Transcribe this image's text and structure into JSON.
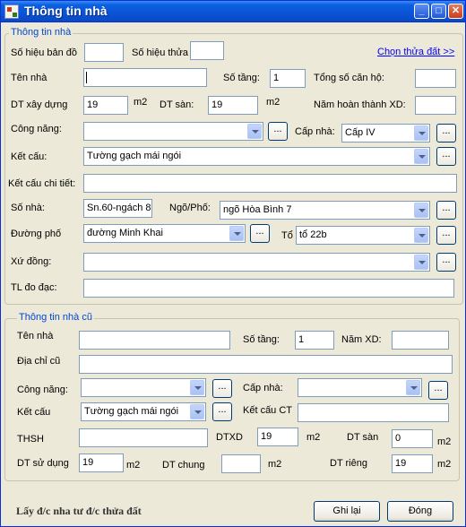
{
  "window": {
    "title": "Thông tin nhà",
    "minimize": "_",
    "maximize": "□",
    "close": "✕"
  },
  "current": {
    "group_title": "Thông tin nhà",
    "so_hieu_ban_do_label": "Số hiệu bản đồ",
    "so_hieu_ban_do_value": "",
    "so_hieu_thua_label": "Số hiệu thửa",
    "so_hieu_thua_value": "",
    "chon_thua_dat_link": "Chọn thửa đất >>",
    "ten_nha_label": "Tên nhà",
    "ten_nha_value": "",
    "so_tang_label": "Số tầng:",
    "so_tang_value": "1",
    "tong_so_can_ho_label": "Tổng số căn hộ:",
    "tong_so_can_ho_value": "",
    "dt_xay_dung_label": "DT xây dựng",
    "dt_xay_dung_value": "19",
    "m2_1": "m2",
    "dt_san_label": "DT sàn:",
    "dt_san_value": "19",
    "m2_2": "m2",
    "nam_hoan_thanh_label": "Năm hoàn thành XD:",
    "nam_hoan_thanh_value": "",
    "cong_nang_label": "Công năng:",
    "cong_nang_value": "",
    "cap_nha_label": "Cấp nhà:",
    "cap_nha_value": "Cấp IV",
    "ket_cau_label": "Kết cấu:",
    "ket_cau_value": "Tường gạch mái ngói",
    "ket_cau_chi_tiet_label": "Kết cấu chi tiết:",
    "ket_cau_chi_tiet_value": "",
    "so_nha_label": "Số nhà:",
    "so_nha_value": "Sn.60-ngách 8",
    "ngo_pho_label": "Ngõ/Phố:",
    "ngo_pho_value": "ngõ Hòa Bình 7",
    "duong_pho_label": "Đường phố",
    "duong_pho_value": "đường Minh Khai",
    "to_label": "Tổ",
    "to_value": "tổ 22b",
    "xu_dong_label": "Xứ đồng:",
    "xu_dong_value": "",
    "tl_do_dac_label": "TL đo đạc:",
    "tl_do_dac_value": ""
  },
  "old": {
    "group_title": "Thông tin nhà cũ",
    "ten_nha_label": "Tên nhà",
    "ten_nha_value": "",
    "so_tang_label": "Số tầng:",
    "so_tang_value": "1",
    "nam_xd_label": "Năm XD:",
    "nam_xd_value": "",
    "dia_chi_cu_label": "Địa chỉ cũ",
    "dia_chi_cu_value": "",
    "cong_nang_label": "Công năng:",
    "cong_nang_value": "",
    "cap_nha_label": "Cấp nhà:",
    "cap_nha_value": "",
    "ket_cau_label": "Kết cấu",
    "ket_cau_value": "Tường gạch mái ngói",
    "ket_cau_ct_label": "Kết cấu CT",
    "ket_cau_ct_value": "",
    "thsh_label": "THSH",
    "thsh_value": "",
    "dtxd_label": "DTXD",
    "dtxd_value": "19",
    "m2_1": "m2",
    "dt_san_label": "DT sàn",
    "dt_san_value": "0",
    "m2_2": "m2",
    "dt_su_dung_label": "DT sử dụng",
    "dt_su_dung_value": "19",
    "m2_3": "m2",
    "dt_chung_label": "DT chung",
    "dt_chung_value": "",
    "m2_4": "m2",
    "dt_rieng_label": "DT riêng",
    "dt_rieng_value": "19",
    "m2_5": "m2"
  },
  "ellipsis": "...",
  "footer": {
    "lay_dc_label": "Lấy đ/c nha tư đ/c thửa đất",
    "ghi_lai": "Ghi lại",
    "dong": "Đóng"
  }
}
